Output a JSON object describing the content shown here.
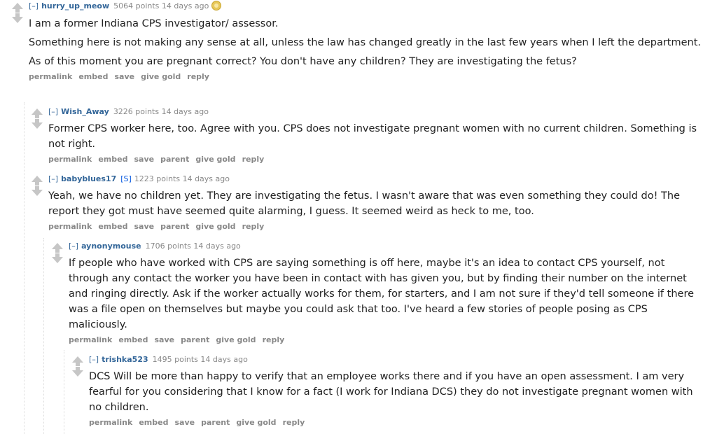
{
  "comments": [
    {
      "toggle": "[–]",
      "author": "hurry_up_meow",
      "meta": "5064 points 14 days ago",
      "paragraphs": [
        "I am a former Indiana CPS investigator/ assessor.",
        "Something here is not making any sense at all, unless the law has changed greatly in the last few years when I left the department.",
        "As of this moment you are pregnant correct? You don't have any children? They are investigating the fetus?"
      ],
      "buttons": [
        "permalink",
        "embed",
        "save",
        "give gold",
        "reply"
      ]
    },
    {
      "toggle": "[–]",
      "author": "Wish_Away",
      "meta": "3226 points 14 days ago",
      "paragraphs": [
        "Former CPS worker here, too. Agree with you. CPS does not investigate pregnant women with no current children. Something is not right."
      ],
      "buttons": [
        "permalink",
        "embed",
        "save",
        "parent",
        "give gold",
        "reply"
      ]
    },
    {
      "toggle": "[–]",
      "author": "babyblues17",
      "submitter": "[S]",
      "meta": "1223 points 14 days ago",
      "paragraphs": [
        "Yeah, we have no children yet. They are investigating the fetus. I wasn't aware that was even something they could do! The report they got must have seemed quite alarming, I guess. It seemed weird as heck to me, too."
      ],
      "buttons": [
        "permalink",
        "embed",
        "save",
        "parent",
        "give gold",
        "reply"
      ]
    },
    {
      "toggle": "[–]",
      "author": "aynonymouse",
      "meta": "1706 points 14 days ago",
      "paragraphs": [
        "If people who have worked with CPS are saying something is off here, maybe it's an idea to contact CPS yourself, not through any contact the worker you have been in contact with has given you, but by finding their number on the internet and ringing directly. Ask if the worker actually works for them, for starters, and I am not sure if they'd tell someone if there was a file open on themselves but maybe you could ask that too. I've heard a few stories of people posing as CPS maliciously."
      ],
      "buttons": [
        "permalink",
        "embed",
        "save",
        "parent",
        "give gold",
        "reply"
      ]
    },
    {
      "toggle": "[–]",
      "author": "trishka523",
      "meta": "1495 points 14 days ago",
      "paragraphs": [
        "DCS Will be more than happy to verify that an employee works there and if you have an open assessment. I am very fearful for you considering that I know for a fact (I work for Indiana DCS) they do not investigate pregnant women with no children."
      ],
      "buttons": [
        "permalink",
        "embed",
        "save",
        "parent",
        "give gold",
        "reply"
      ]
    }
  ]
}
